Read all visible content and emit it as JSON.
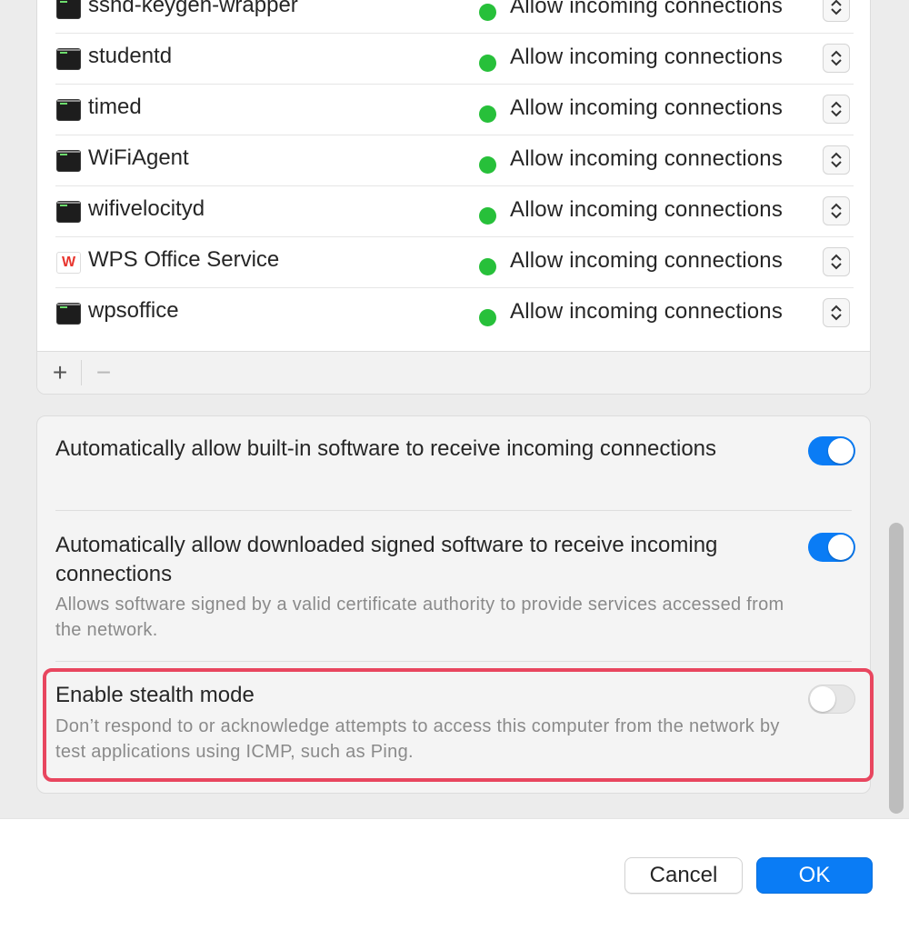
{
  "app_list": {
    "rows": [
      {
        "name": "sshd-keygen-wrapper",
        "icon": "terminal-icon",
        "status": "Allow incoming connections"
      },
      {
        "name": "studentd",
        "icon": "terminal-icon",
        "status": "Allow incoming connections"
      },
      {
        "name": "timed",
        "icon": "terminal-icon",
        "status": "Allow incoming connections"
      },
      {
        "name": "WiFiAgent",
        "icon": "terminal-icon",
        "status": "Allow incoming connections"
      },
      {
        "name": "wifivelocityd",
        "icon": "terminal-icon",
        "status": "Allow incoming connections"
      },
      {
        "name": "WPS Office Service",
        "icon": "wps-office-icon",
        "status": "Allow incoming connections"
      },
      {
        "name": "wpsoffice",
        "icon": "terminal-icon",
        "status": "Allow incoming connections"
      }
    ],
    "status_color": "#27c03a",
    "add_label": "+",
    "remove_label": "−"
  },
  "options": {
    "builtin": {
      "title": "Automatically allow built-in software to receive incoming connections",
      "enabled": true
    },
    "signed": {
      "title": "Automatically allow downloaded signed software to receive incoming connections",
      "description": "Allows software signed by a valid certificate authority to provide services accessed from the network.",
      "enabled": true
    },
    "stealth": {
      "title": "Enable stealth mode",
      "description": "Don’t respond to or acknowledge attempts to access this computer from the network by test applications using ICMP, such as Ping.",
      "enabled": false
    }
  },
  "buttons": {
    "cancel": "Cancel",
    "ok": "OK"
  },
  "colors": {
    "accent": "#0a7cf5",
    "highlight": "#e8465f"
  }
}
